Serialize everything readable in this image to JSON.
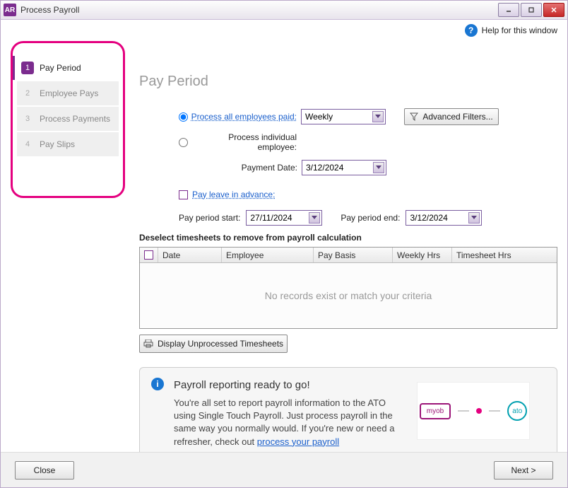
{
  "titlebar": {
    "app_icon_text": "AR",
    "title": "Process Payroll"
  },
  "help": {
    "label": "Help for this window"
  },
  "sidebar": {
    "steps": [
      {
        "num": "1",
        "label": "Pay Period"
      },
      {
        "num": "2",
        "label": "Employee Pays"
      },
      {
        "num": "3",
        "label": "Process Payments"
      },
      {
        "num": "4",
        "label": "Pay Slips"
      }
    ]
  },
  "page": {
    "title": "Pay Period"
  },
  "form": {
    "process_all_label": "Process all employees paid:",
    "frequency": "Weekly",
    "advanced_filters": "Advanced Filters...",
    "process_individual_label": "Process individual employee:",
    "payment_date_label": "Payment Date:",
    "payment_date": "3/12/2024",
    "pay_leave_label": "Pay leave in advance:",
    "pay_period_start_label": "Pay period start:",
    "pay_period_start": "27/11/2024",
    "pay_period_end_label": "Pay period end:",
    "pay_period_end": "3/12/2024"
  },
  "timesheets": {
    "header": "Deselect timesheets to remove from payroll calculation",
    "columns": {
      "date": "Date",
      "employee": "Employee",
      "pay_basis": "Pay Basis",
      "weekly_hrs": "Weekly Hrs",
      "timesheet_hrs": "Timesheet Hrs"
    },
    "empty": "No records exist or match your criteria",
    "display_button": "Display Unprocessed Timesheets"
  },
  "info": {
    "heading": "Payroll reporting ready to go!",
    "body_prefix": "You're all set to report payroll information to the ATO using Single Touch Payroll. Just process payroll in the same way you normally would. If you're new or need a refresher, check out ",
    "link_text": "process your payroll",
    "graphic": {
      "myob": "myob",
      "ato": "ato"
    }
  },
  "footer": {
    "close": "Close",
    "next": "Next >"
  }
}
